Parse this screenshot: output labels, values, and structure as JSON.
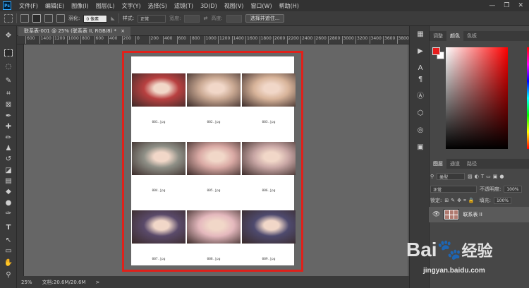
{
  "app": {
    "logo": "Ps"
  },
  "menu": [
    "文件(F)",
    "编辑(E)",
    "图像(I)",
    "图层(L)",
    "文字(Y)",
    "选择(S)",
    "滤镜(T)",
    "3D(D)",
    "视图(V)",
    "窗口(W)",
    "帮助(H)"
  ],
  "window_controls": [
    "—",
    "❐",
    "✕"
  ],
  "options": {
    "feather_label": "羽化:",
    "feather_value": "0 像素",
    "style_label": "样式:",
    "style_value": "正常",
    "width_label": "宽度:",
    "height_label": "高度:",
    "select_mask_button": "选择并遮住..."
  },
  "document": {
    "tab_title": "联系表-001 @ 25% (联系表 II, RGB/8) *",
    "tab_close": "×"
  },
  "ruler_labels": [
    "600",
    "1400",
    "1200",
    "1000",
    "800",
    "600",
    "400",
    "200",
    "0",
    "200",
    "400",
    "600",
    "800",
    "1000",
    "1200",
    "1400",
    "1600",
    "1800",
    "2000",
    "2200",
    "2400",
    "2600",
    "2800",
    "3000",
    "3200",
    "3400",
    "3600",
    "3800"
  ],
  "contact_sheet": {
    "items": [
      {
        "caption": "001.jpg",
        "color": "#b84040"
      },
      {
        "caption": "002.jpg",
        "color": "#c9a892"
      },
      {
        "caption": "003.jpg",
        "color": "#d8b49a"
      },
      {
        "caption": "004.jpg",
        "color": "#8e8f86"
      },
      {
        "caption": "005.jpg",
        "color": "#d9a9a4"
      },
      {
        "caption": "006.jpg",
        "color": "#c9a7a5"
      },
      {
        "caption": "007.jpg",
        "color": "#5a4a6a"
      },
      {
        "caption": "008.jpg",
        "color": "#e4b8bd"
      },
      {
        "caption": "009.jpg",
        "color": "#4e4a6e"
      }
    ]
  },
  "status": {
    "zoom": "25%",
    "doc_info": "文档:20.6M/20.6M",
    "arrow": ">"
  },
  "panels": {
    "color_tabs": [
      "调整",
      "颜色",
      "色板"
    ],
    "layer_tabs": [
      "图层",
      "通道",
      "路径"
    ],
    "kind_filter": "类型",
    "blend_mode": "正常",
    "opacity_label": "不透明度:",
    "opacity_value": "100%",
    "lock_label": "锁定:",
    "fill_label": "填充:",
    "fill_value": "100%",
    "layer_name": "联系表 II",
    "foreground_color": "#e81e1e",
    "background_color": "#ffffff"
  },
  "watermark": {
    "brand": "Bai",
    "brand_cn": "经验",
    "url": "jingyan.baidu.com"
  }
}
